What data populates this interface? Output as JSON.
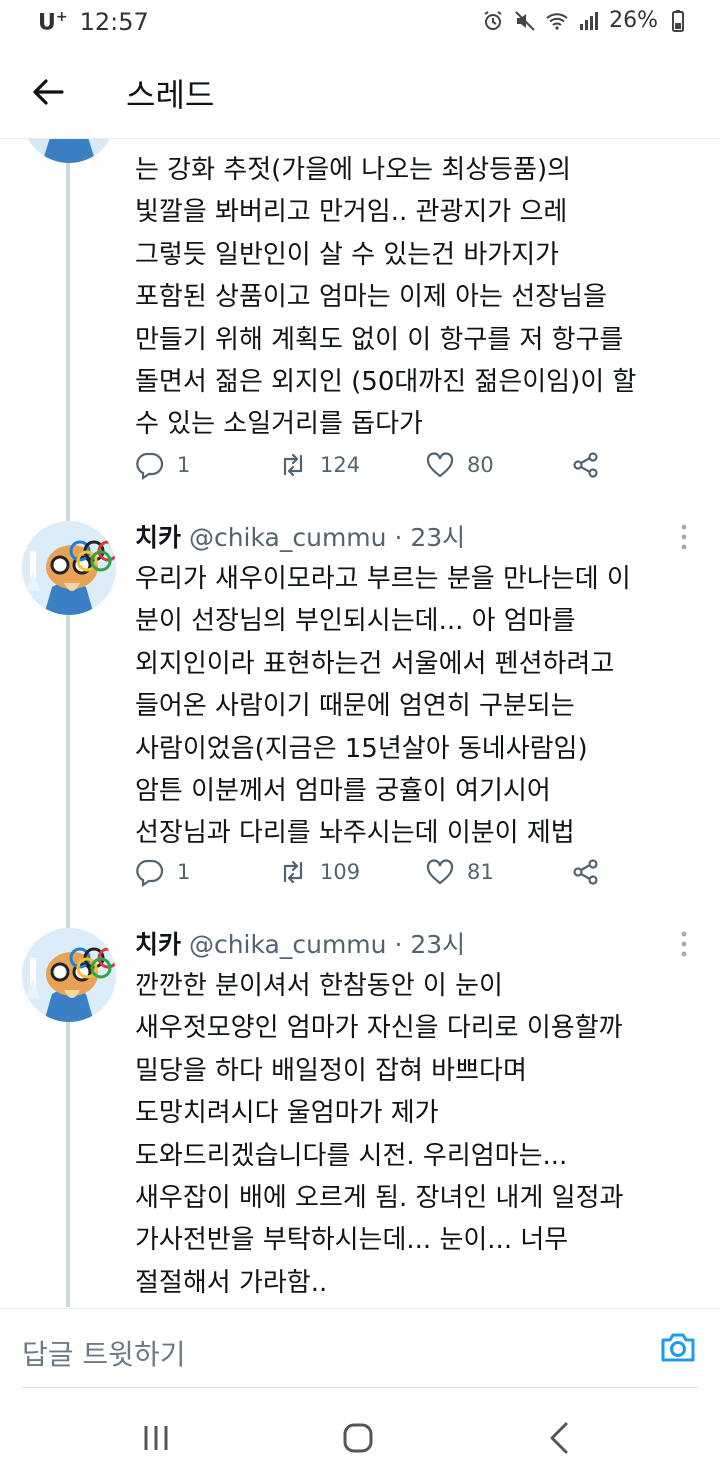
{
  "status_bar": {
    "carrier": "U",
    "carrier_sup": "+",
    "time": "12:57",
    "battery": "26%"
  },
  "header": {
    "title": "스레드"
  },
  "tweets": [
    {
      "text_lines": [
        "는 강화 추젓(가을에 나오는 최상등품)의",
        "빛깔을 봐버리고 만거임.. 관광지가 으레",
        "그렇듯 일반인이 살 수 있는건 바가지가",
        "포함된 상품이고 엄마는 이제 아는 선장님을",
        "만들기 위해 계획도 없이 이 항구를 저 항구를",
        "돌면서 젊은 외지인 (50대까진 젊은이임)이 할",
        "수 있는 소일거리를 돕다가"
      ],
      "replies": "1",
      "retweets": "124",
      "likes": "80"
    },
    {
      "name": "치카",
      "handle": "@chika_cummu",
      "time": "· 23시",
      "text_lines": [
        "우리가 새우이모라고 부르는 분을 만나는데 이",
        "분이 선장님의 부인되시는데... 아 엄마를",
        "외지인이라 표현하는건 서울에서 펜션하려고",
        "들어온 사람이기 때문에 엄연히 구분되는",
        "사람이었음(지금은 15년살아 동네사람임)",
        "암튼 이분께서 엄마를 궁휼이 여기시어",
        "선장님과 다리를 놔주시는데 이분이 제법"
      ],
      "replies": "1",
      "retweets": "109",
      "likes": "81"
    },
    {
      "name": "치카",
      "handle": "@chika_cummu",
      "time": "· 23시",
      "text_lines": [
        "깐깐한 분이셔서 한참동안 이 눈이",
        "새우젓모양인 엄마가 자신을 다리로 이용할까",
        "밀당을 하다 배일정이 잡혀 바쁘다며",
        "도망치려시다 울엄마가 제가",
        "도와드리겠습니다를 시전. 우리엄마는...",
        "새우잡이 배에 오르게 됨. 장녀인 내게 일정과",
        "가사전반을 부탁하시는데... 눈이... 너무",
        "절절해서 가라함.."
      ]
    }
  ],
  "reply_bar": {
    "placeholder": "답글 트윗하기"
  },
  "colors": {
    "text": "#0f1419",
    "muted": "#536471",
    "accent": "#1d9bf0",
    "thread_line": "#cfd9de"
  },
  "icons": [
    "back-arrow-icon",
    "reply-icon",
    "retweet-icon",
    "like-icon",
    "share-icon",
    "more-icon",
    "camera-icon",
    "recent-apps-icon",
    "home-icon",
    "nav-back-icon"
  ]
}
